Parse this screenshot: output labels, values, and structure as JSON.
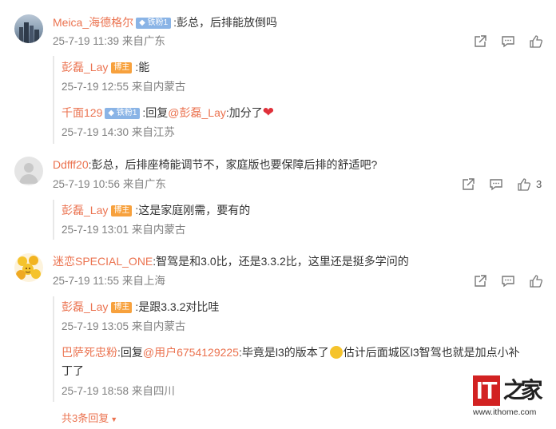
{
  "comments": [
    {
      "user": "Meica_海德格尔",
      "badge": "铁粉1",
      "text": ":彭总，后排能放倒吗",
      "meta": "25-7-19 11:39 来自广东",
      "like_count": "",
      "replies": [
        {
          "user": "彭磊_Lay",
          "badge": "博主",
          "text": ":能",
          "meta": "25-7-19 12:55 来自内蒙古"
        },
        {
          "user": "千面129",
          "badge": "铁粉1",
          "text_prefix": ":回复",
          "mention": "@彭磊_Lay",
          "text": ":加分了",
          "emoji": "❤",
          "meta": "25-7-19 14:30 来自江苏"
        }
      ]
    },
    {
      "user": "Ddfff20",
      "text": ":彭总，后排座椅能调节不，家庭版也要保障后排的舒适吧?",
      "meta": "25-7-19 10:56 来自广东",
      "like_count": "3",
      "replies": [
        {
          "user": "彭磊_Lay",
          "badge": "博主",
          "text": ":这是家庭刚需，要有的",
          "meta": "25-7-19 13:01 来自内蒙古"
        }
      ]
    },
    {
      "user": "迷恋SPECIAL_ONE",
      "text": ":智驾是和3.0比，还是3.3.2比，这里还是挺多学问的",
      "meta": "25-7-19 11:55 来自上海",
      "like_count": "",
      "replies": [
        {
          "user": "彭磊_Lay",
          "badge": "博主",
          "text": ":是跟3.3.2对比哇",
          "meta": "25-7-19 13:05 来自内蒙古"
        },
        {
          "user": "巴萨死忠粉",
          "text_prefix": ":回复",
          "mention": "@用户6754129225",
          "text": ":毕竟是l3的版本了",
          "text2": "估计后面城区l3智驾也就是加点小补",
          "text3": "丁了",
          "meta": "25-7-19 18:58 来自四川"
        }
      ],
      "more_replies": "共3条回复"
    }
  ],
  "watermark": {
    "it": "IT",
    "home": "之家",
    "url": "www.ithome.com"
  },
  "colors": {
    "name": "#eb7350",
    "meta": "#808080",
    "fan_badge": "#8ab4e6",
    "blog_badge": "#f7a13d",
    "logo_red": "#d22222"
  }
}
